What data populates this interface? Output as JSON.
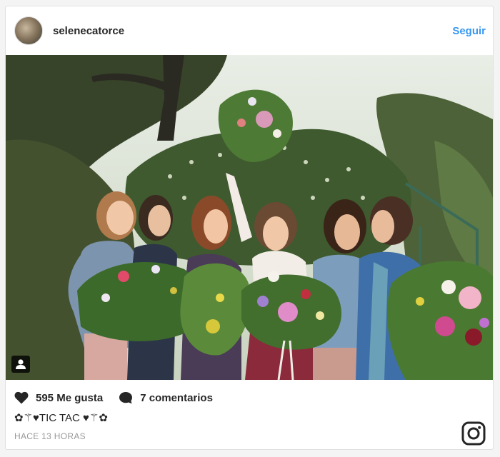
{
  "post": {
    "username": "selenecatorce",
    "follow_label": "Seguir",
    "likes_text": "595 Me gusta",
    "comments_text": "7 comentarios",
    "caption": "✿⚚♥TIC TAC ♥⚚✿",
    "time_ago": "HACE 13 HORAS"
  },
  "icons": {
    "like": "heart-icon",
    "comment": "comment-bubble-icon",
    "brand": "instagram-logo-icon",
    "user_tag": "user-tag-icon"
  },
  "colors": {
    "follow": "#3897f0",
    "text": "#262626",
    "muted": "#999999"
  }
}
